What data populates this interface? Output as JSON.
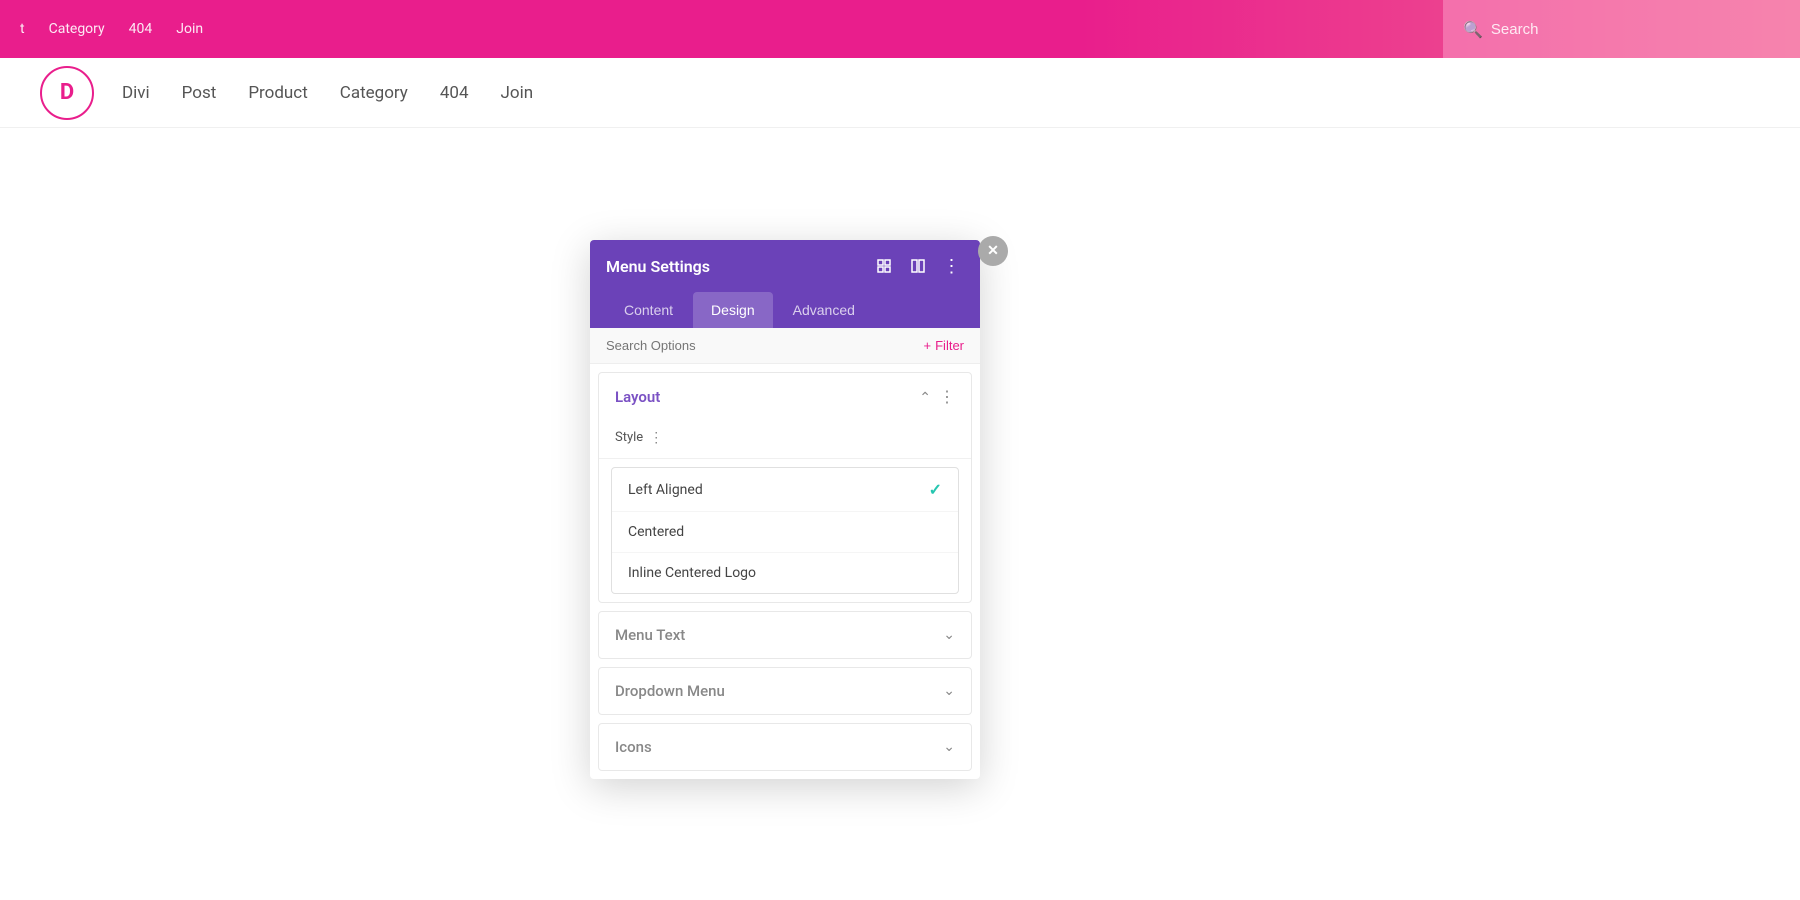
{
  "topbar": {
    "nav_items": [
      "t",
      "Category",
      "404",
      "Join"
    ],
    "search_placeholder": "Search"
  },
  "mainnav": {
    "logo_letter": "D",
    "links": [
      "Divi",
      "Post",
      "Product",
      "Category",
      "404",
      "Join"
    ]
  },
  "panel": {
    "title": "Menu Settings",
    "header_icons": [
      "expand",
      "columns",
      "dots"
    ],
    "tabs": [
      {
        "label": "Content",
        "active": false
      },
      {
        "label": "Design",
        "active": true
      },
      {
        "label": "Advanced",
        "active": false
      }
    ],
    "search_placeholder": "Search Options",
    "filter_label": "+ Filter",
    "sections": {
      "layout": {
        "title": "Layout",
        "style_label": "Style",
        "options": [
          {
            "label": "Left Aligned",
            "selected": true
          },
          {
            "label": "Centered",
            "selected": false
          },
          {
            "label": "Inline Centered Logo",
            "selected": false
          }
        ]
      },
      "menu_text": {
        "title": "Menu Text",
        "collapsed": true
      },
      "dropdown_menu": {
        "title": "Dropdown Menu",
        "collapsed": true
      },
      "icons": {
        "title": "Icons",
        "collapsed": true
      }
    }
  }
}
